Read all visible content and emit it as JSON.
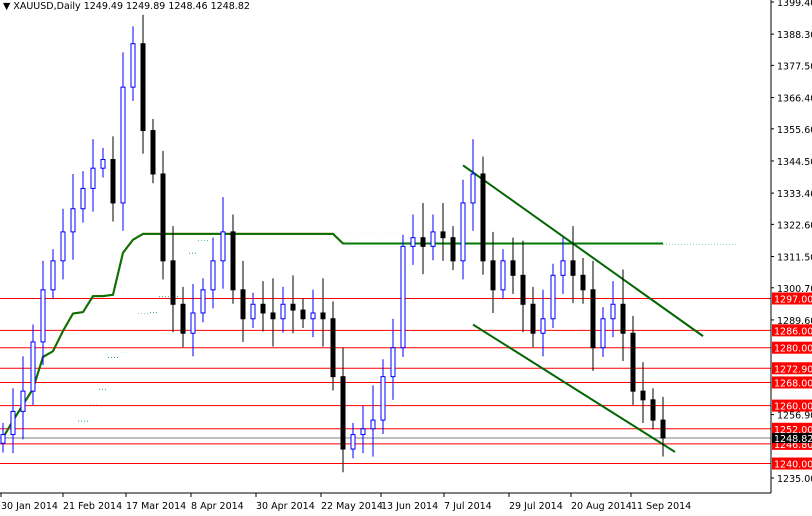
{
  "header": {
    "symbol": "XAUUSD,Daily",
    "ohlc": "1249.49 1249.89 1248.46 1248.82"
  },
  "colors": {
    "bull": "#0000ff",
    "bear": "#000000",
    "tenkan": "#ff0000",
    "kijun": "#007700",
    "cloud_up": "#22aa66",
    "cloud_down": "#ff5500",
    "level": "#ff0000",
    "trend": "#006400",
    "current": "#808080"
  },
  "chart_data": {
    "type": "candlestick",
    "title": "XAUUSD,Daily",
    "ylim": [
      1235.0,
      1399.4
    ],
    "y_ticks": [
      "1399.40",
      "1388.30",
      "1377.50",
      "1366.40",
      "1355.60",
      "1344.50",
      "1333.40",
      "1322.60",
      "1311.50",
      "1300.70",
      "1289.60",
      "1256.90",
      "1235.00"
    ],
    "x_ticks": [
      {
        "i": 0,
        "label": "30 Jan 2014"
      },
      {
        "i": 6.2,
        "label": "21 Feb 2014"
      },
      {
        "i": 12.5,
        "label": "17 Mar 2014"
      },
      {
        "i": 19,
        "label": "8 Apr 2014"
      },
      {
        "i": 25.5,
        "label": "30 Apr 2014"
      },
      {
        "i": 32,
        "label": "22 May 2014"
      },
      {
        "i": 38,
        "label": "13 Jun 2014"
      },
      {
        "i": 44.3,
        "label": "7 Jul 2014"
      },
      {
        "i": 50.8,
        "label": "29 Jul 2014"
      },
      {
        "i": 57,
        "label": "20 Aug 2014"
      },
      {
        "i": 63,
        "label": "11 Sep 2014"
      }
    ],
    "closes": [
      1250,
      1258,
      1265,
      1282,
      1300,
      1310,
      1320,
      1328,
      1335,
      1342,
      1345,
      1330,
      1370,
      1385,
      1355,
      1340,
      1310,
      1295,
      1285,
      1292,
      1300,
      1310,
      1320,
      1300,
      1290,
      1295,
      1292,
      1290,
      1295,
      1293,
      1290,
      1292,
      1290,
      1270,
      1245,
      1250,
      1252,
      1255,
      1270,
      1280,
      1315,
      1318,
      1315,
      1320,
      1318,
      1310,
      1330,
      1340,
      1310,
      1300,
      1310,
      1305,
      1295,
      1285,
      1290,
      1305,
      1310,
      1305,
      1300,
      1280,
      1290,
      1295,
      1285,
      1265,
      1262,
      1255,
      1248.82
    ],
    "levels": [
      {
        "price": 1297.0,
        "label": "1297.00"
      },
      {
        "price": 1286.0,
        "label": "1286.00"
      },
      {
        "price": 1280.0,
        "label": "1280.00"
      },
      {
        "price": 1272.9,
        "label": "1272.90"
      },
      {
        "price": 1268.0,
        "label": "1268.00"
      },
      {
        "price": 1260.0,
        "label": "1260.00"
      },
      {
        "price": 1252.0,
        "label": "1252.00"
      },
      {
        "price": 1246.8,
        "label": "1246.80"
      },
      {
        "price": 1240.0,
        "label": "1240.00"
      }
    ],
    "current_price": {
      "price": 1248.82,
      "label": "1248.82"
    },
    "trendlines": [
      {
        "i1": 46,
        "p1": 1343,
        "i2": 70,
        "p2": 1284
      },
      {
        "i1": 47,
        "p1": 1288,
        "i2": 67.2,
        "p2": 1244
      }
    ]
  }
}
